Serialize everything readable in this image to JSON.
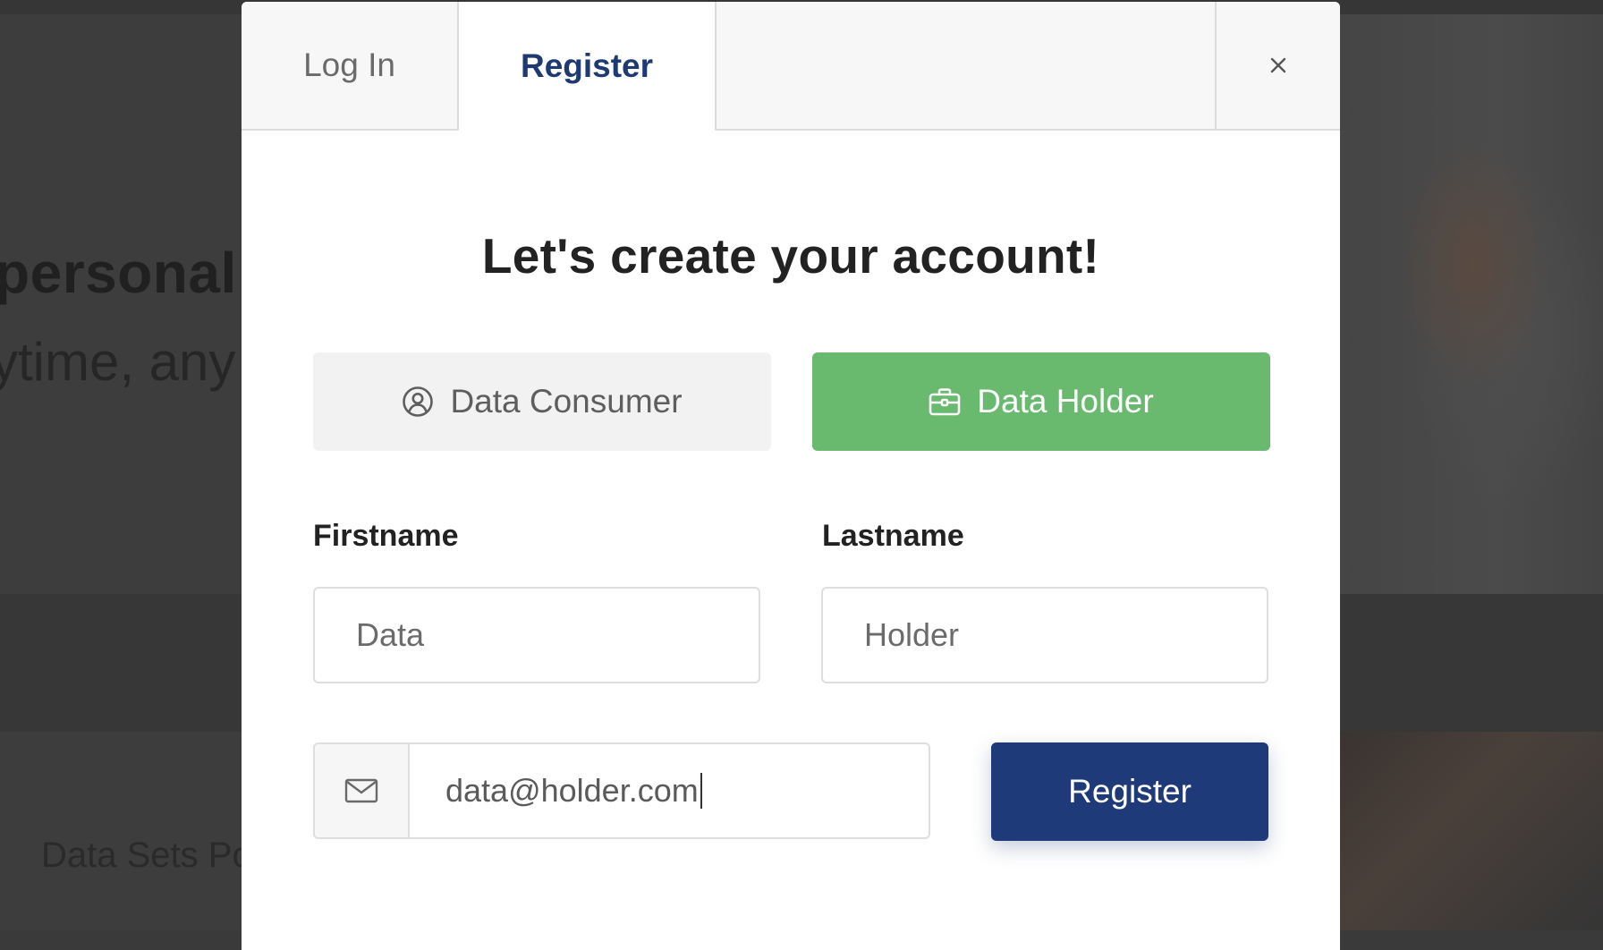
{
  "background": {
    "headline": "personal",
    "subline": "ytime, any",
    "datasets_text": "Data Sets Po"
  },
  "modal": {
    "tabs": {
      "login": "Log In",
      "register": "Register",
      "close": "×"
    },
    "title": "Let's create your account!",
    "roles": {
      "consumer": "Data Consumer",
      "holder": "Data Holder",
      "selected": "holder"
    },
    "firstname": {
      "label": "Firstname",
      "value": "Data"
    },
    "lastname": {
      "label": "Lastname",
      "value": "Holder"
    },
    "email": {
      "value": "data@holder.com"
    },
    "submit_label": "Register"
  },
  "icons": {
    "consumer": "user-circle-icon",
    "holder": "briefcase-icon",
    "email": "envelope-icon",
    "close": "close-icon"
  },
  "colors": {
    "brand_navy": "#1f3a78",
    "holder_green": "#69b96f",
    "consumer_gray": "#f2f2f2"
  }
}
